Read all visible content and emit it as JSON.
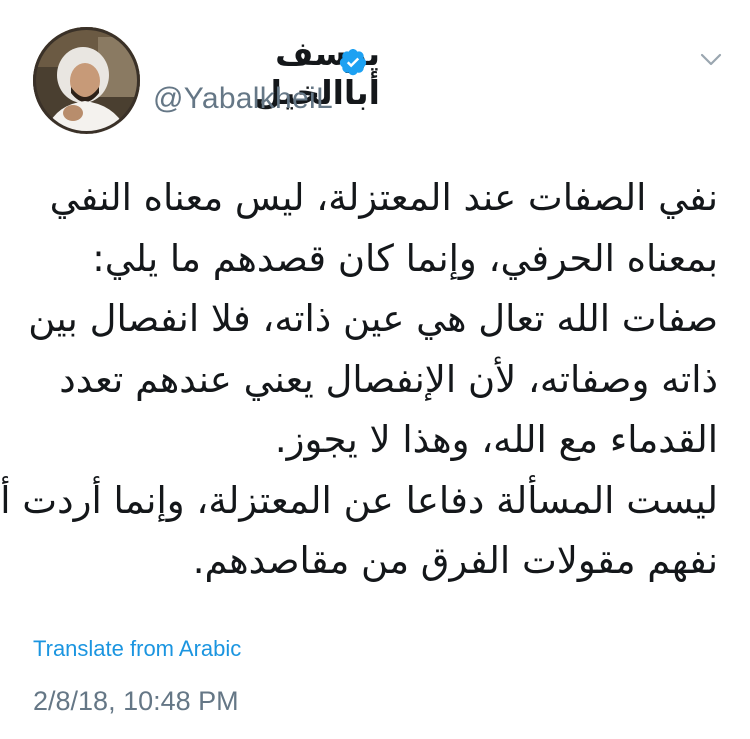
{
  "tweet": {
    "display_name": "يوسف أباالخيل",
    "handle": "@YabalkheiL",
    "verified_icon": "verified-badge-icon",
    "menu_icon": "chevron-down-icon",
    "avatar_icon": "avatar",
    "lines": [
      "نفي الصفات عند المعتزلة، ليس معناه النفي",
      "بمعناه الحرفي، وإنما كان قصدهم ما يلي:",
      "صفات الله تعال هي عين ذاته، فلا انفصال بين",
      "ذاته وصفاته، لأن الإنفصال يعني عندهم تعدد",
      "القدماء مع الله، وهذا لا يجوز.",
      "ليست المسألة دفاعا عن المعتزلة، وإنما أردت أن",
      "نفهم مقولات الفرق من مقاصدهم."
    ],
    "translate_label": "Translate from Arabic",
    "timestamp": "2/8/18, 10:48 PM",
    "colors": {
      "text": "#14171a",
      "secondary": "#657786",
      "link": "#1b95e0",
      "verified": "#1da1f2"
    }
  }
}
